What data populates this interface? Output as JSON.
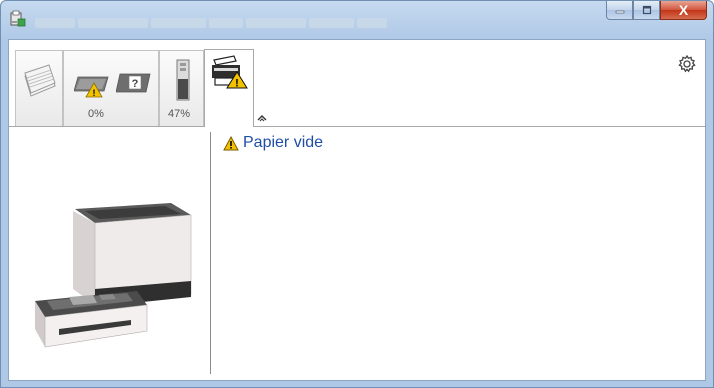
{
  "window": {
    "icons": {
      "app": "printer-app-icon",
      "minimize": "minimize-icon",
      "maximize": "maximize-icon",
      "close": "close-icon"
    },
    "close_glyph": "X"
  },
  "tabs": [
    {
      "name": "paper-stack",
      "label": ""
    },
    {
      "name": "toner-unknown",
      "label": "0%"
    },
    {
      "name": "toner-level",
      "label": "47%"
    },
    {
      "name": "printer-warning",
      "label": ""
    }
  ],
  "toolbar": {
    "gear_icon": "gear-icon",
    "collapse_icon": "chevron-up-icon"
  },
  "status": {
    "icon": "warning-icon",
    "message": "Papier vide"
  },
  "colors": {
    "accent": "#1f4fa5",
    "warning": "#f2c200",
    "close_button": "#c13518"
  }
}
